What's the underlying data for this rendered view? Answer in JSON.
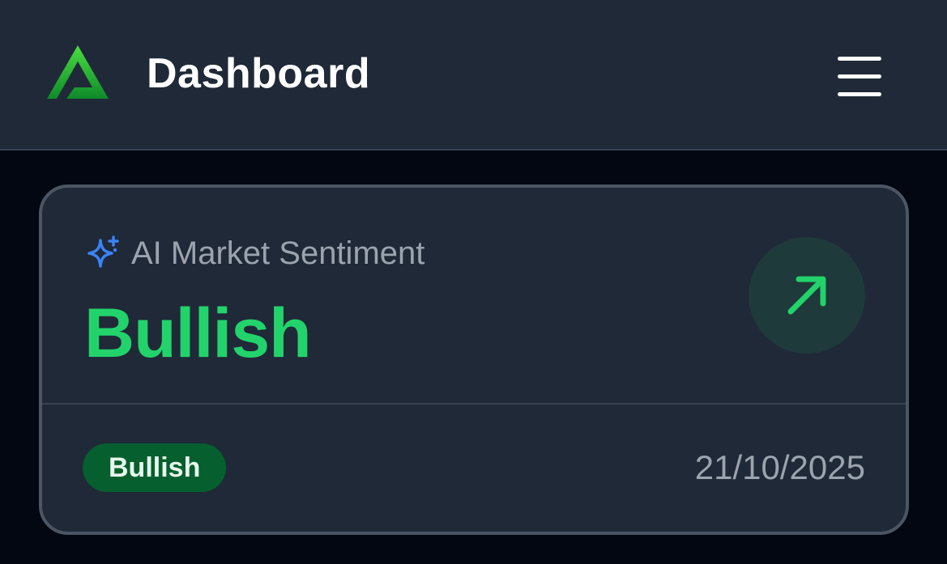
{
  "header": {
    "logo_icon": "a-triangle-logo-icon",
    "title": "Dashboard",
    "menu_icon": "hamburger-menu-icon"
  },
  "sentiment_card": {
    "label_icon": "sparkle-icon",
    "label": "AI Market Sentiment",
    "value": "Bullish",
    "trend_icon": "arrow-up-right-icon",
    "badge": "Bullish",
    "date": "21/10/2025"
  },
  "colors": {
    "header_bg": "#1f2937",
    "page_bg": "#030712",
    "accent_green": "#22d36b",
    "badge_bg": "#065f2e",
    "sparkle_blue": "#3b82f6",
    "muted_text": "#9ca3af"
  }
}
